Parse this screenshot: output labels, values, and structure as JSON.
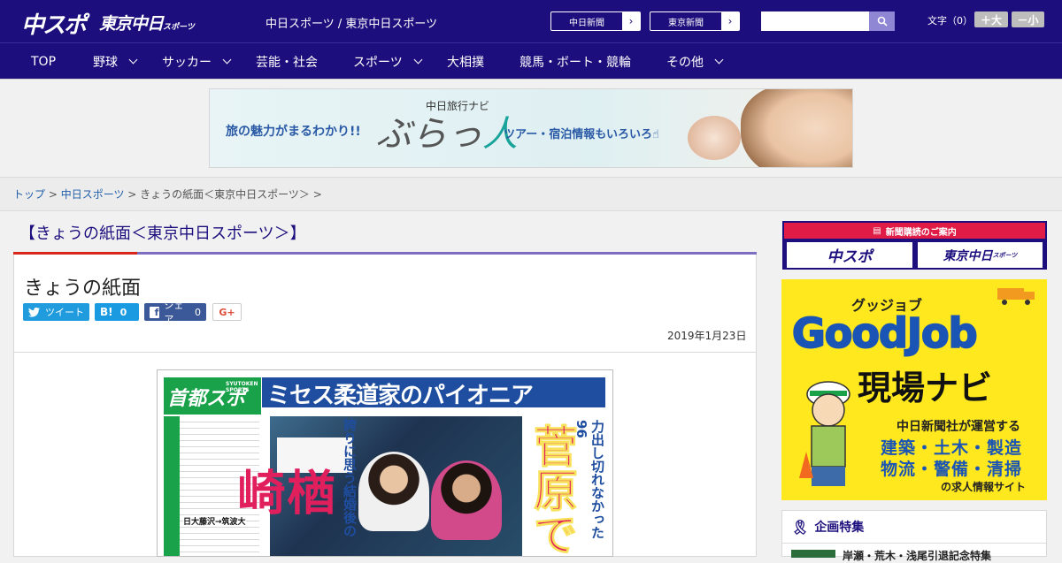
{
  "header": {
    "logo_chuspo": "中スポ",
    "logo_tokyo": "東京中日",
    "logo_tokyo_suffix": "スポーツ",
    "site_title": "中日スポーツ / 東京中日スポーツ",
    "news_buttons": [
      "中日新聞",
      "東京新聞"
    ],
    "search_placeholder": "",
    "font_label": "文字（0）",
    "font_plus": "＋大",
    "font_minus": "－小"
  },
  "nav": {
    "items": [
      {
        "label": "TOP",
        "dropdown": false
      },
      {
        "label": "野球",
        "dropdown": true
      },
      {
        "label": "サッカー",
        "dropdown": true
      },
      {
        "label": "芸能・社会",
        "dropdown": false
      },
      {
        "label": "スポーツ",
        "dropdown": true
      },
      {
        "label": "大相撲",
        "dropdown": false
      },
      {
        "label": "競馬・ボート・競輪",
        "dropdown": false
      },
      {
        "label": "その他",
        "dropdown": true
      }
    ]
  },
  "banner": {
    "small": "中日旅行ナビ",
    "left": "旅の魅力がまるわかり!!",
    "brand_a": "ぶらっ",
    "brand_b": "人",
    "right": "ツアー・宿泊情報もいろいろ"
  },
  "breadcrumb": {
    "items": [
      "トップ",
      "中日スポーツ",
      "きょうの紙面＜東京中日スポーツ＞"
    ],
    "separator": " > "
  },
  "main": {
    "page_heading": "【きょうの紙面＜東京中日スポーツ＞】",
    "article_title": "きょうの紙面",
    "share": {
      "tweet": "ツイート",
      "hatena_label": "B!",
      "hatena_count": "0",
      "facebook_label": "シェア",
      "facebook_count": "0",
      "gplus": "G+"
    },
    "date": "2019年1月23日"
  },
  "paper": {
    "masthead": "首都スポ",
    "masthead_en": "SYUTOKEN SPORTS",
    "headline": "ミセス柔道家のパイオニア",
    "sub_vertical": "誇りに思う結婚後の",
    "big_vertical": "楢崎",
    "right_vertical": "力出し切れなかった96",
    "hot_vertical": "菅原で",
    "left_item": "日大藤沢→筑波大"
  },
  "sidebar": {
    "subscribe_title": "新聞購読のご案内",
    "subscribe_chuspo": "中スポ",
    "subscribe_tokyo": "東京中日",
    "subscribe_tokyo_suffix": "スポーツ",
    "goodjob": {
      "kana": "グッジョブ",
      "name": "GoodJob",
      "navi": "現場ナビ",
      "line1": "中日新聞社が運営する",
      "line2": "建築・土木・製造",
      "line3": "物流・警備・清掃",
      "line4": "の求人情報サイト"
    },
    "feature": {
      "title": "企画特集",
      "item": "岸瀬・荒木・浅尾引退記念特集"
    }
  },
  "colors": {
    "brand_navy": "#1c0f7d",
    "accent_red": "#d8261b",
    "accent_purple": "#7e6ec1",
    "twitter": "#1f9bde",
    "hatena": "#1a9ae0",
    "facebook": "#3b5998"
  }
}
